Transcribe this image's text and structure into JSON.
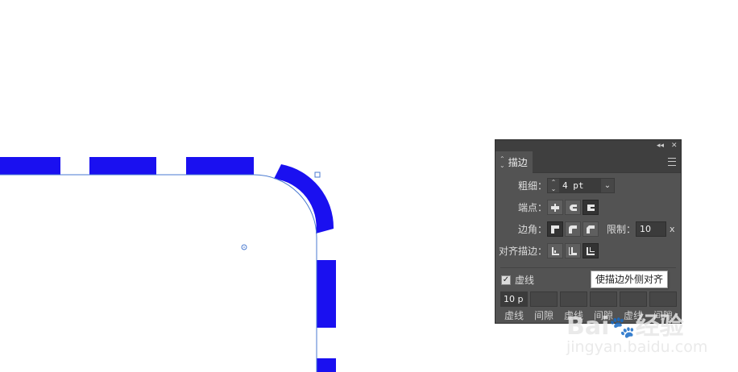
{
  "canvas": {
    "stroke_color": "#1a10f0",
    "path_color": "#4a7ad0"
  },
  "panel": {
    "tab_label": "描边",
    "weight": {
      "label": "粗细：",
      "value": "4 pt"
    },
    "cap": {
      "label": "端点："
    },
    "corner": {
      "label": "边角：",
      "limit_label": "限制：",
      "limit_value": "10",
      "limit_suffix": "x"
    },
    "align": {
      "label": "对齐描边："
    },
    "dashed": {
      "label": "虚线",
      "checked": true,
      "first_value": "10 p",
      "labels": [
        "虚线",
        "间隙",
        "虚线",
        "间隙",
        "虚线",
        "间隙"
      ]
    }
  },
  "tooltip": {
    "text": "使描边外侧对齐"
  },
  "watermark": {
    "brand": "Bai",
    "brand2": "经验",
    "url": "jingyan.baidu.com"
  },
  "icons": {
    "cap": [
      "butt-cap-icon",
      "round-cap-icon",
      "projecting-cap-icon"
    ],
    "corner": [
      "miter-join-icon",
      "round-join-icon",
      "bevel-join-icon"
    ],
    "align": [
      "align-center-icon",
      "align-inside-icon",
      "align-outside-icon"
    ]
  }
}
